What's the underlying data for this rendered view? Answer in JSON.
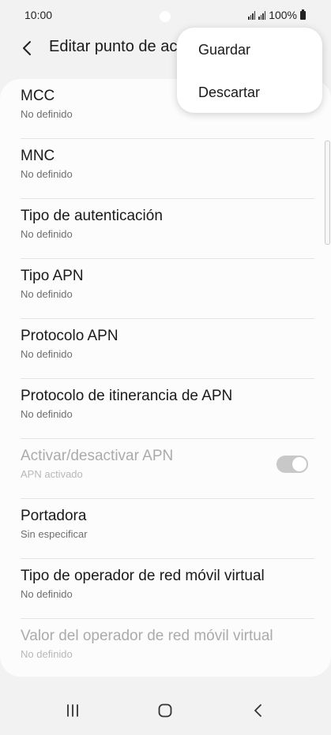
{
  "status": {
    "time": "10:00",
    "battery": "100%"
  },
  "header": {
    "title": "Editar punto de acceso"
  },
  "menu": {
    "items": [
      "Guardar",
      "Descartar"
    ]
  },
  "items": [
    {
      "title": "MCC",
      "subtitle": "No definido"
    },
    {
      "title": "MNC",
      "subtitle": "No definido"
    },
    {
      "title": "Tipo de autenticación",
      "subtitle": "No definido"
    },
    {
      "title": "Tipo APN",
      "subtitle": "No definido"
    },
    {
      "title": "Protocolo APN",
      "subtitle": "No definido"
    },
    {
      "title": "Protocolo de itinerancia de APN",
      "subtitle": "No definido"
    },
    {
      "title": "Activar/desactivar APN",
      "subtitle": "APN activado",
      "toggle_on": true,
      "enabled": false
    },
    {
      "title": "Portadora",
      "subtitle": "Sin especificar"
    },
    {
      "title": "Tipo de operador de red móvil virtual",
      "subtitle": "No definido"
    },
    {
      "title": "Valor del operador de red móvil virtual",
      "subtitle": "No definido",
      "enabled": false
    }
  ],
  "icons": {
    "back": "chevron-left-icon",
    "nav_recents": "recent-apps-icon",
    "nav_home": "home-icon",
    "nav_back": "back-icon"
  }
}
